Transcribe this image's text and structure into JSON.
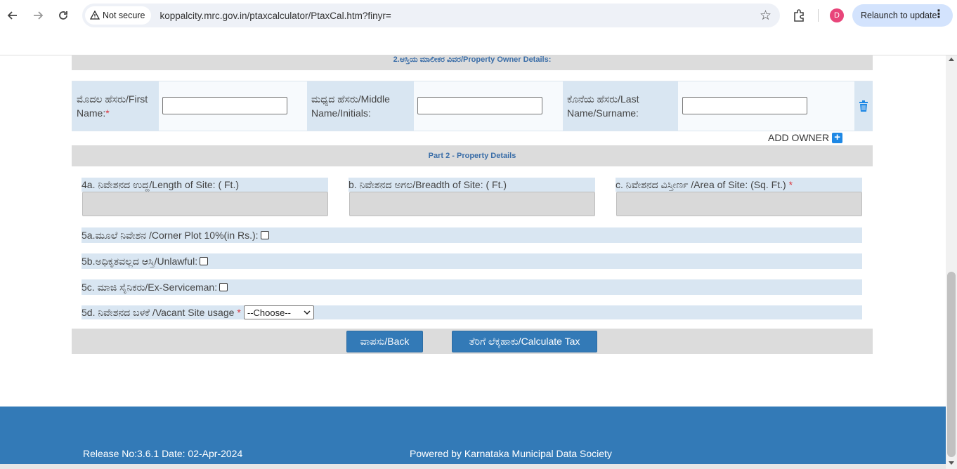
{
  "browser": {
    "security_label": "Not secure",
    "url": "koppalcity.mrc.gov.in/ptaxcalculator/PtaxCal.htm?finyr=",
    "avatar_letter": "D",
    "relaunch_label": "Relaunch to update"
  },
  "owner_section": {
    "title": "2.ಆಸ್ತಿಯ ಮಾಲೀಕರ ವಿವರ/Property Owner Details:",
    "first_name_label": "ಮೊದಲ ಹೆಸರು/First Name:",
    "middle_name_label": "ಮಧ್ಯದ ಹೆಸರು/Middle Name/Initials:",
    "last_name_label": "ಕೊನೆಯ ಹೆಸರು/Last Name/Surname:",
    "required_mark": "*",
    "add_owner_label": "ADD OWNER"
  },
  "property_section": {
    "title": "Part 2 - Property Details",
    "length_label": "4a. ನಿವೇಶನದ ಉದ್ದ/Length of Site: ( Ft.)",
    "breadth_label": "b. ನಿವೇಶನದ ಅಗಲ/Breadth of Site: ( Ft.)",
    "area_label": "c. ನಿವೇಶನದ ವಿಸ್ತೀರ್ಣ /Area of Site: (Sq. Ft.)",
    "required_mark": "*",
    "corner_label": "5a.ಮೂಲೆ ನಿವೇಶನ /Corner Plot 10%(in Rs.):",
    "unlawful_label": "5b.ಅಧಿಕೃತವಲ್ಲದ ಆಸ್ತಿ/Unlawful:",
    "exservice_label": "5c. ಮಾಜಿ ಸೈನಿಕರು/Ex-Serviceman:",
    "usage_label": "5d. ನಿವೇಶನದ ಬಳಕೆ /Vacant Site usage",
    "usage_selected": "--Choose--"
  },
  "buttons": {
    "back": "ವಾಪಸು/Back",
    "calculate": "ತೆರಿಗೆ ಲೆಕ್ಕಹಾಕು/Calculate Tax"
  },
  "footer": {
    "release": "Release No:3.6.1 Date: 02-Apr-2024",
    "powered": "Powered by Karnataka Municipal Data Society"
  },
  "colors": {
    "accent": "#337ab7",
    "label_bg": "#d9e6f2",
    "section_bg": "#dcdcdc",
    "required": "#d9363e"
  }
}
